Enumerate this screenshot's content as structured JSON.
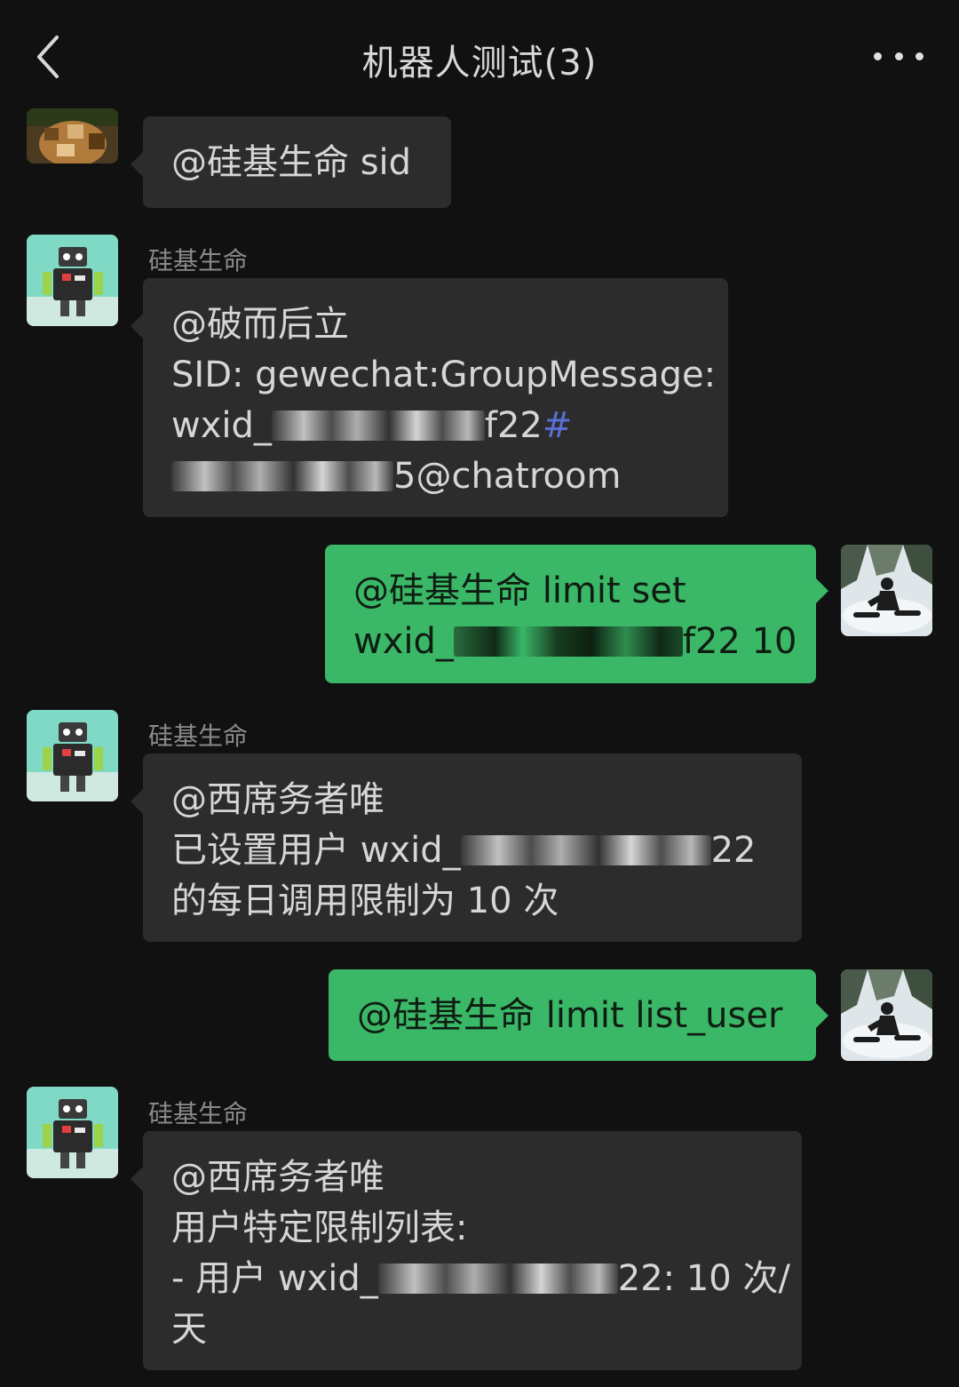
{
  "header": {
    "title": "机器人测试(3)"
  },
  "messages": [
    {
      "side": "left",
      "sender": "",
      "avatar": "user-avatar-icon",
      "lines": [
        "@硅基生命  sid"
      ]
    },
    {
      "side": "left",
      "sender": "硅基生命",
      "avatar": "robot-avatar-icon",
      "lines": [
        "@破而后立",
        "SID: gewechat:GroupMessage:",
        {
          "pre": "wxid_",
          "post": "f22",
          "hash": "#"
        },
        {
          "pre": "",
          "post": "5@chatroom"
        }
      ]
    },
    {
      "side": "right",
      "sender": "",
      "avatar": "snowboarder-avatar-icon",
      "lines": [
        "@硅基生命  limit set",
        {
          "pre": "wxid_",
          "post": "f22 10"
        }
      ]
    },
    {
      "side": "left",
      "sender": "硅基生命",
      "avatar": "robot-avatar-icon",
      "lines": [
        "@西席务者唯",
        {
          "pre": "已设置用户 wxid_",
          "post": "22"
        },
        "的每日调用限制为 10 次"
      ]
    },
    {
      "side": "right",
      "sender": "",
      "avatar": "snowboarder-avatar-icon",
      "lines": [
        "@硅基生命  limit list_user"
      ]
    },
    {
      "side": "left",
      "sender": "硅基生命",
      "avatar": "robot-avatar-icon",
      "lines": [
        "@西席务者唯",
        "用户特定限制列表:",
        {
          "pre": "- 用户 wxid_",
          "post": "22: 10 次/"
        },
        "天"
      ]
    }
  ]
}
